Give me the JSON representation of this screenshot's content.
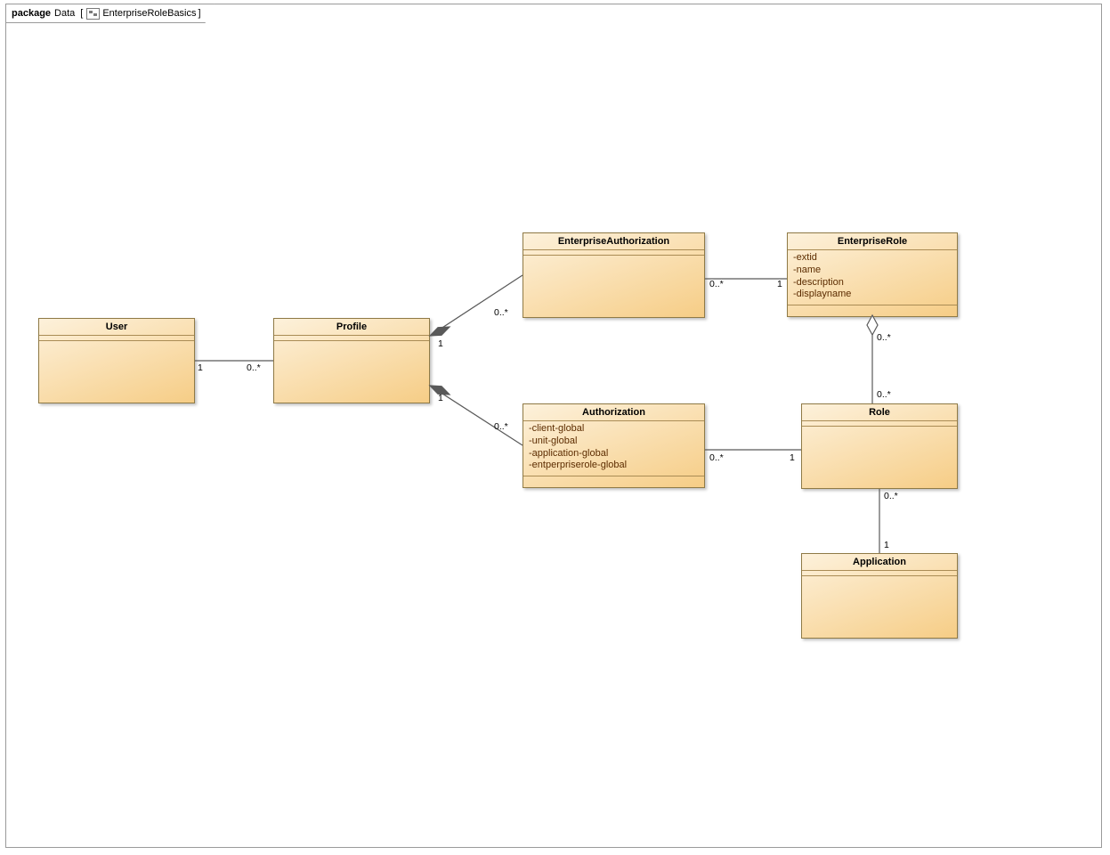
{
  "tab": {
    "kind": "package",
    "name": "Data",
    "diagram": "EnterpriseRoleBasics"
  },
  "classes": {
    "user": {
      "name": "User"
    },
    "profile": {
      "name": "Profile"
    },
    "entAuth": {
      "name": "EnterpriseAuthorization"
    },
    "auth": {
      "name": "Authorization",
      "attrs": [
        "-client-global",
        "-unit-global",
        "-application-global",
        "-entperpriserole-global"
      ]
    },
    "entRole": {
      "name": "EnterpriseRole",
      "attrs": [
        "-extid",
        "-name",
        "-description",
        "-displayname"
      ]
    },
    "role": {
      "name": "Role"
    },
    "application": {
      "name": "Application"
    }
  },
  "mult": {
    "user_profile_l": "1",
    "user_profile_r": "0..*",
    "profile_entauth_profile": "1",
    "profile_entauth_other": "0..*",
    "profile_auth_profile": "1",
    "profile_auth_other": "0..*",
    "entauth_entrole_l": "0..*",
    "entauth_entrole_r": "1",
    "auth_role_l": "0..*",
    "auth_role_r": "1",
    "entrole_role_top": "0..*",
    "entrole_role_bot": "0..*",
    "role_app_top": "0..*",
    "role_app_bot": "1"
  },
  "chart_data": {
    "type": "uml-class",
    "package": "Data",
    "diagram": "EnterpriseRoleBasics",
    "classes": [
      {
        "id": "User",
        "name": "User",
        "attributes": [],
        "operations": []
      },
      {
        "id": "Profile",
        "name": "Profile",
        "attributes": [],
        "operations": []
      },
      {
        "id": "EnterpriseAuthorization",
        "name": "EnterpriseAuthorization",
        "attributes": [],
        "operations": []
      },
      {
        "id": "Authorization",
        "name": "Authorization",
        "attributes": [
          "client-global",
          "unit-global",
          "application-global",
          "entperpriserole-global"
        ],
        "operations": []
      },
      {
        "id": "EnterpriseRole",
        "name": "EnterpriseRole",
        "attributes": [
          "extid",
          "name",
          "description",
          "displayname"
        ],
        "operations": []
      },
      {
        "id": "Role",
        "name": "Role",
        "attributes": [],
        "operations": []
      },
      {
        "id": "Application",
        "name": "Application",
        "attributes": [],
        "operations": []
      }
    ],
    "relations": [
      {
        "from": "User",
        "to": "Profile",
        "type": "association",
        "from_mult": "1",
        "to_mult": "0..*"
      },
      {
        "from": "Profile",
        "to": "EnterpriseAuthorization",
        "type": "composition",
        "whole": "Profile",
        "from_mult": "1",
        "to_mult": "0..*"
      },
      {
        "from": "Profile",
        "to": "Authorization",
        "type": "composition",
        "whole": "Profile",
        "from_mult": "1",
        "to_mult": "0..*"
      },
      {
        "from": "EnterpriseAuthorization",
        "to": "EnterpriseRole",
        "type": "association",
        "from_mult": "0..*",
        "to_mult": "1"
      },
      {
        "from": "Authorization",
        "to": "Role",
        "type": "association",
        "from_mult": "0..*",
        "to_mult": "1"
      },
      {
        "from": "EnterpriseRole",
        "to": "Role",
        "type": "aggregation",
        "whole": "EnterpriseRole",
        "from_mult": "0..*",
        "to_mult": "0..*"
      },
      {
        "from": "Role",
        "to": "Application",
        "type": "association",
        "from_mult": "0..*",
        "to_mult": "1"
      }
    ]
  }
}
